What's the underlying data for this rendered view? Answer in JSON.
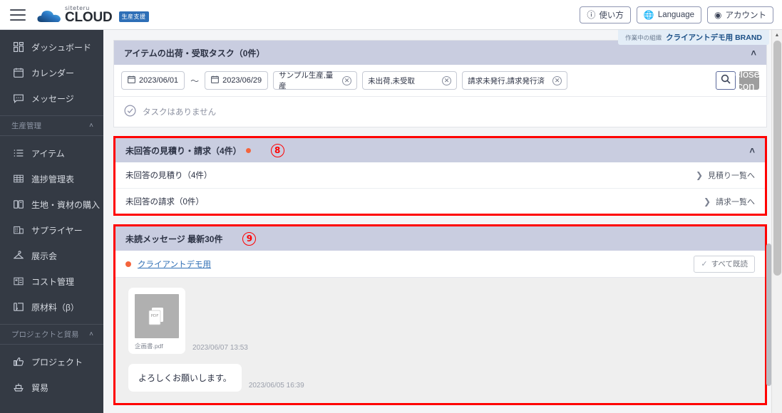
{
  "topbar": {
    "menu_icon": "hamburger-icon",
    "brand_sub": "siteteru",
    "brand_main": "CLOUD",
    "brand_badge": "生産支援",
    "buttons": [
      {
        "icon": "help-circle-icon",
        "label": "使い方"
      },
      {
        "icon": "globe-icon",
        "label": "Language"
      },
      {
        "icon": "account-circle-icon",
        "label": "アカウント"
      }
    ]
  },
  "org_badge": {
    "label": "作業中の組織",
    "value": "クライアントデモ用 BRAND"
  },
  "sidebar": {
    "items": [
      {
        "icon": "dashboard-icon",
        "label": "ダッシュボード"
      },
      {
        "icon": "calendar-icon",
        "label": "カレンダー"
      },
      {
        "icon": "message-icon",
        "label": "メッセージ"
      }
    ],
    "groups": [
      {
        "label": "生産管理",
        "chevron": "˄",
        "items": [
          {
            "icon": "list-icon",
            "label": "アイテム"
          },
          {
            "icon": "table-icon",
            "label": "進捗管理表"
          },
          {
            "icon": "fabric-icon",
            "label": "生地・資材の購入"
          },
          {
            "icon": "building-icon",
            "label": "サプライヤー"
          },
          {
            "icon": "hanger-icon",
            "label": "展示会"
          },
          {
            "icon": "cost-icon",
            "label": "コスト管理"
          },
          {
            "icon": "material-icon",
            "label": "原材料（β）"
          }
        ]
      },
      {
        "label": "プロジェクトと貿易",
        "chevron": "˄",
        "items": [
          {
            "icon": "thumb-up-icon",
            "label": "プロジェクト"
          },
          {
            "icon": "ship-icon",
            "label": "貿易"
          }
        ]
      }
    ]
  },
  "task_panel": {
    "title": "アイテムの出荷・受取タスク（0件）",
    "collapse_chevron": "˄",
    "date_from": "2023/06/01",
    "date_to": "2023/06/29",
    "date_separator": "～",
    "chips": [
      {
        "label": "サンプル生産,量産",
        "clear": "✕"
      },
      {
        "label": "未出荷,未受取",
        "clear": "✕"
      },
      {
        "label": "請求未発行,請求発行済",
        "clear": "✕"
      }
    ],
    "search_icon": "search-icon",
    "clear_icon": "close-icon",
    "empty_text": "タスクはありません",
    "empty_icon": "check-circle-icon"
  },
  "quote_panel": {
    "title": "未回答の見積り・請求（4件）",
    "annotation": "8",
    "collapse_chevron": "˄",
    "rows": [
      {
        "label": "未回答の見積り（4件）",
        "link": "見積り一覧へ",
        "chevron": "❯"
      },
      {
        "label": "未回答の請求（0件）",
        "link": "請求一覧へ",
        "chevron": "❯"
      }
    ]
  },
  "message_panel": {
    "title": "未読メッセージ 最新30件",
    "annotation": "9",
    "org_link": "クライアントデモ用",
    "read_all_label": "すべて既読",
    "read_all_check": "✓",
    "messages": [
      {
        "type": "file",
        "file_badge": "PDF",
        "file_name": "企画書.pdf",
        "timestamp": "2023/06/07 13:53"
      },
      {
        "type": "text",
        "text": "よろしくお願いします。",
        "timestamp": "2023/06/05 16:39"
      }
    ]
  },
  "colors": {
    "accent_red": "#ff0000",
    "header_lavender": "#c9cde0",
    "sidebar_dark": "#343a44",
    "unread_dot": "#f4643c",
    "link_blue": "#2f6fb5"
  }
}
